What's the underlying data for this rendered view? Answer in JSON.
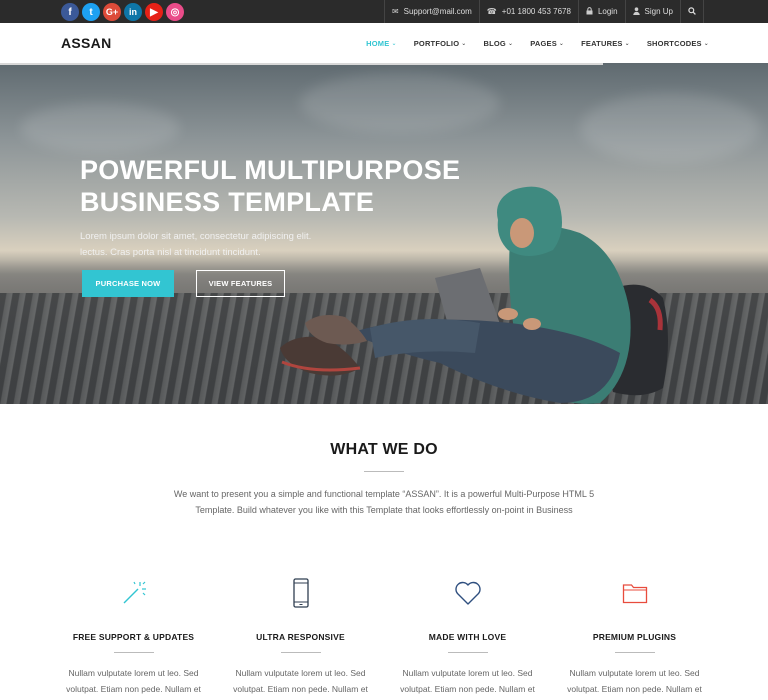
{
  "topbar": {
    "socials": [
      {
        "name": "facebook-icon",
        "glyph": "f"
      },
      {
        "name": "twitter-icon",
        "glyph": "t"
      },
      {
        "name": "google-plus-icon",
        "glyph": "G+"
      },
      {
        "name": "linkedin-icon",
        "glyph": "in"
      },
      {
        "name": "youtube-icon",
        "glyph": "▶"
      },
      {
        "name": "dribbble-icon",
        "glyph": "◎"
      }
    ],
    "email": "Support@mail.com",
    "phone": "+01 1800 453 7678",
    "login": "Login",
    "signup": "Sign Up"
  },
  "nav": {
    "logo": "ASSAN",
    "items": [
      {
        "label": "HOME",
        "active": true
      },
      {
        "label": "PORTFOLIO",
        "active": false
      },
      {
        "label": "BLOG",
        "active": false
      },
      {
        "label": "PAGES",
        "active": false
      },
      {
        "label": "FEATURES",
        "active": false
      },
      {
        "label": "SHORTCODES",
        "active": false
      }
    ]
  },
  "hero": {
    "title_line1": "POWERFUL MULTIPURPOSE",
    "title_line2": "BUSINESS TEMPLATE",
    "text_line1": "Lorem ipsum dolor sit amet, consectetur adipiscing elit.",
    "text_line2": "lectus. Cras porta nisl at tincidunt tincidunt.",
    "purchase_label": "PURCHASE NOW",
    "view_label": "VIEW FEATURES"
  },
  "whatwedo": {
    "title": "WHAT WE DO",
    "text_line1": "We want to present you a simple and functional template “ASSAN”. It is a powerful Multi-Purpose HTML 5",
    "text_line2": "Template. Build whatever you like with this Template that looks effortlessly on-point in Business"
  },
  "features": [
    {
      "icon": "magic-wand-icon",
      "title": "FREE SUPPORT & UPDATES",
      "line1": "Nullam vulputate lorem ut leo. Sed",
      "line2": "volutpat. Etiam non pede. Nullam et"
    },
    {
      "icon": "mobile-phone-icon",
      "title": "ULTRA RESPONSIVE",
      "line1": "Nullam vulputate lorem ut leo. Sed",
      "line2": "volutpat. Etiam non pede. Nullam et"
    },
    {
      "icon": "heart-icon",
      "title": "MADE WITH LOVE",
      "line1": "Nullam vulputate lorem ut leo. Sed",
      "line2": "volutpat. Etiam non pede. Nullam et"
    },
    {
      "icon": "folder-icon",
      "title": "PREMIUM PLUGINS",
      "line1": "Nullam vulputate lorem ut leo. Sed",
      "line2": "volutpat. Etiam non pede. Nullam et"
    }
  ],
  "colors": {
    "accent": "#32c5d2",
    "topbar": "#2b2b2b",
    "icon_red": "#e84c3d",
    "icon_blue": "#2f4f7f"
  }
}
